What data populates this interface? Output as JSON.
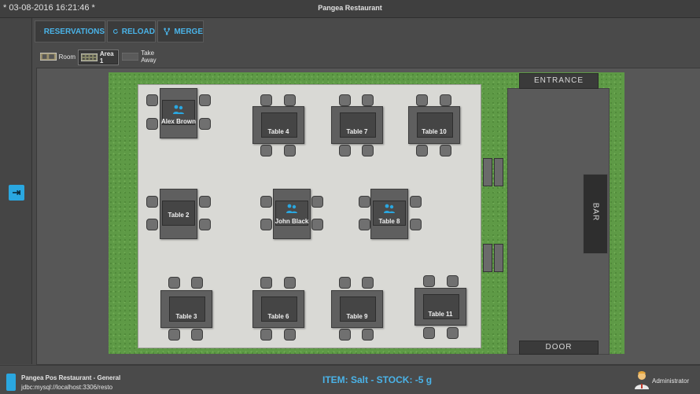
{
  "window": {
    "timestamp": "*  03-08-2016 16:21:46  *",
    "title": "Pangea Restaurant"
  },
  "toolbar": {
    "reservations_label": "RESERVATIONS",
    "reload_label": "RELOAD",
    "merge_label": "MERGE"
  },
  "tabs": [
    {
      "label": "Room",
      "icon": "room-icon",
      "active": false
    },
    {
      "label": "Area 1",
      "icon": "area-icon",
      "active": true
    },
    {
      "label": "Take Away",
      "icon": "takeaway-icon",
      "active": false
    }
  ],
  "floor": {
    "entrance_label": "ENTRANCE",
    "door_label": "DOOR",
    "bar_label": "BAR",
    "tables": [
      {
        "label": "Alex Brown",
        "occupied": true
      },
      {
        "label": "Table 4",
        "occupied": false
      },
      {
        "label": "Table 7",
        "occupied": false
      },
      {
        "label": "Table 10",
        "occupied": false
      },
      {
        "label": "Table 2",
        "occupied": false
      },
      {
        "label": "John Black",
        "occupied": true
      },
      {
        "label": "Table 8",
        "occupied": true
      },
      {
        "label": "Table 3",
        "occupied": false
      },
      {
        "label": "Table 6",
        "occupied": false
      },
      {
        "label": "Table 9",
        "occupied": false
      },
      {
        "label": "Table 11",
        "occupied": false
      }
    ]
  },
  "status": {
    "app_name": "Pangea Pos Restaurant - General",
    "connection": "jdbc:mysql://localhost:3306/resto",
    "item_status": "ITEM: Salt  - STOCK: -5 g",
    "user": "Administrator"
  },
  "colors": {
    "accent": "#2aa7e0",
    "grass": "#5e9a46",
    "floor": "#d9d9d5"
  }
}
